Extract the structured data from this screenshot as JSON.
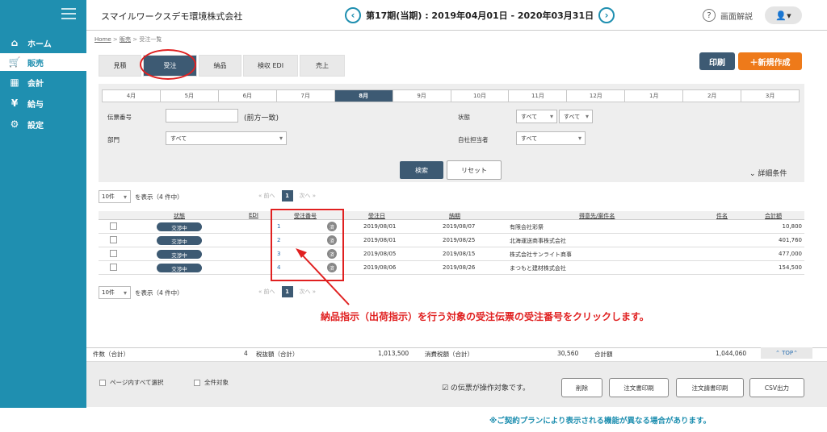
{
  "app": {
    "company": "スマイルワークスデモ環境株式会社",
    "period": "第17期(当期) : 2019年04月01日 - 2020年03月31日",
    "help": "画面解説"
  },
  "sidebar": {
    "items": [
      {
        "label": "ホーム",
        "icon": "home-icon",
        "glyph": "⌂"
      },
      {
        "label": "販売",
        "icon": "cart-icon",
        "glyph": "🛒"
      },
      {
        "label": "会計",
        "icon": "calculator-icon",
        "glyph": "▦"
      },
      {
        "label": "給与",
        "icon": "money-bag-icon",
        "glyph": "¥"
      },
      {
        "label": "設定",
        "icon": "gear-icon",
        "glyph": "⚙"
      }
    ]
  },
  "breadcrumb": {
    "home": "Home",
    "sep1": " > ",
    "sales": "販売",
    "sep2": " > ",
    "current": "受注一覧"
  },
  "tabs": [
    {
      "label": "見積"
    },
    {
      "label": "受注"
    },
    {
      "label": "納品"
    },
    {
      "label": "検収 EDI"
    },
    {
      "label": "売上"
    }
  ],
  "actions": {
    "print": "印刷",
    "new": "＋新規作成"
  },
  "months": [
    "4月",
    "5月",
    "6月",
    "7月",
    "8月",
    "9月",
    "10月",
    "11月",
    "12月",
    "1月",
    "2月",
    "3月"
  ],
  "filters": {
    "slip_no_label": "伝票番号",
    "slip_no_hint": "(前方一致)",
    "dept_label": "部門",
    "dept_value": "すべて",
    "status_label": "状態",
    "status_value1": "すべて",
    "status_value2": "すべて",
    "staff_label": "自社担当者",
    "staff_value": "すべて",
    "search": "検索",
    "reset": "リセット",
    "detail": "⌄ 詳細条件"
  },
  "pager": {
    "per_page": "10件",
    "showing": "を表示（4 件中）",
    "prev": "« 前へ",
    "page": "1",
    "next": "次へ »"
  },
  "table": {
    "headers": {
      "status": "状態",
      "edi": "EDI",
      "order_no": "受注番号",
      "order_date": "受注日",
      "delivery": "納期",
      "customer": "得意先/案件名",
      "subject": "件名",
      "total": "合計額"
    },
    "rows": [
      {
        "status": "交渉中",
        "no": "1",
        "mark": "済",
        "date": "2019/08/01",
        "due": "2019/08/07",
        "customer": "有限会社彩祭",
        "total": "10,800"
      },
      {
        "status": "交渉中",
        "no": "2",
        "mark": "済",
        "date": "2019/08/01",
        "due": "2019/08/25",
        "customer": "北海運送商事株式会社",
        "total": "401,760"
      },
      {
        "status": "交渉中",
        "no": "3",
        "mark": "済",
        "date": "2019/08/05",
        "due": "2019/08/15",
        "customer": "株式会社サンライト商事",
        "total": "477,000"
      },
      {
        "status": "交渉中",
        "no": "4",
        "mark": "済",
        "date": "2019/08/06",
        "due": "2019/08/26",
        "customer": "まつもと建材株式会社",
        "total": "154,500"
      }
    ]
  },
  "annotation": "納品指示（出荷指示）を行う対象の受注伝票の受注番号をクリックします。",
  "summary": {
    "count_label": "件数（合計）",
    "count": "4",
    "taxex_label": "税抜額（合計）",
    "taxex": "1,013,500",
    "tax_label": "消費税額（合計）",
    "tax": "30,560",
    "total_label": "合計額",
    "total": "1,044,060",
    "top": "⌃ TOP⌃"
  },
  "bottom": {
    "select_page": "ページ内すべて選択",
    "select_all": "全件対象",
    "target": "☑ の伝票が操作対象です。",
    "delete": "削除",
    "print_order": "注文書印刷",
    "print_invoice": "注文請書印刷",
    "csv": "CSV出力"
  },
  "note": "※ご契約プランにより表示される機能が異なる場合があります。"
}
